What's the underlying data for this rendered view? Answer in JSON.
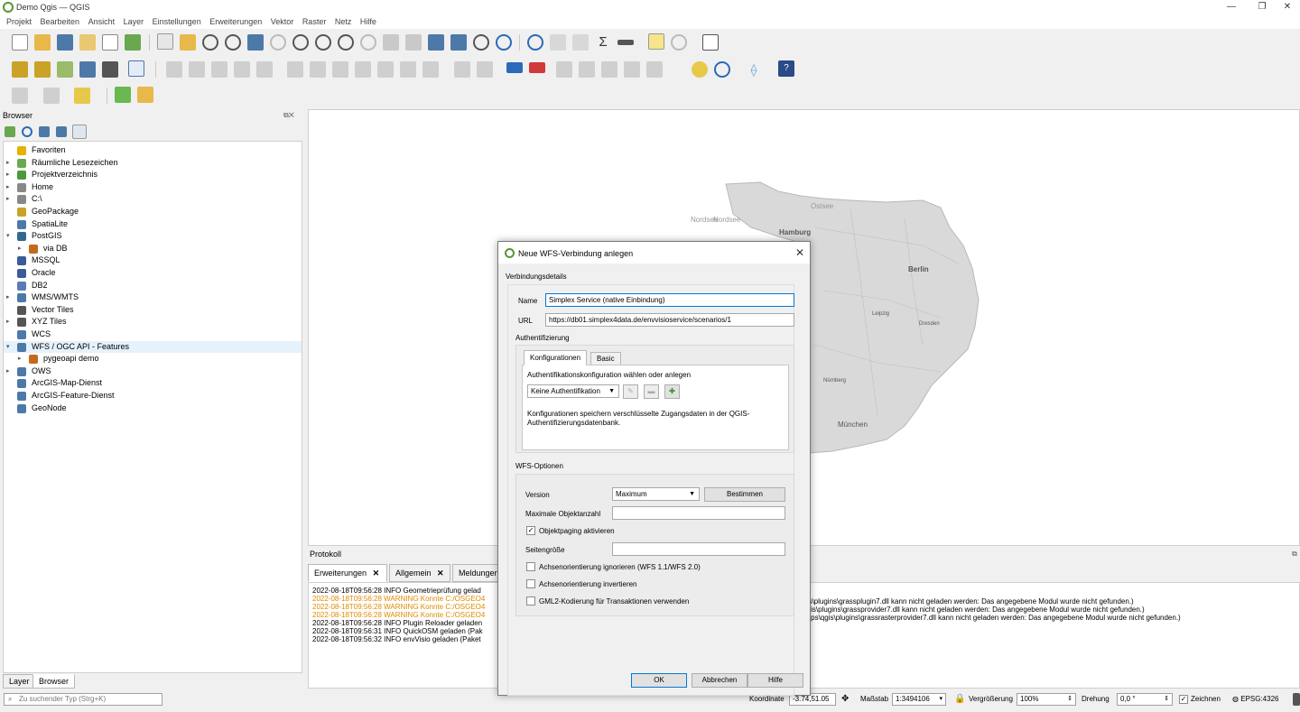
{
  "window": {
    "title": "Demo Qgis — QGIS",
    "minimize": "—",
    "restore": "❐",
    "close": "✕"
  },
  "menu": [
    "Projekt",
    "Bearbeiten",
    "Ansicht",
    "Layer",
    "Einstellungen",
    "Erweiterungen",
    "Vektor",
    "Raster",
    "Netz",
    "Hilfe"
  ],
  "browser": {
    "title": "Browser",
    "items": [
      {
        "label": "Favoriten",
        "icon": "star-icon",
        "color": "#e8b000",
        "arrow": ""
      },
      {
        "label": "Räumliche Lesezeichen",
        "icon": "bookmark-icon",
        "color": "#6aa84f",
        "arrow": "▸"
      },
      {
        "label": "Projektverzeichnis",
        "icon": "project-folder-icon",
        "color": "#4a9a3a",
        "arrow": "▸"
      },
      {
        "label": "Home",
        "icon": "home-icon",
        "color": "#888888",
        "arrow": "▸"
      },
      {
        "label": "C:\\",
        "icon": "drive-icon",
        "color": "#888888",
        "arrow": "▸"
      },
      {
        "label": "GeoPackage",
        "icon": "geopackage-icon",
        "color": "#c9a227",
        "arrow": ""
      },
      {
        "label": "SpatiaLite",
        "icon": "spatialite-icon",
        "color": "#4d79a8",
        "arrow": ""
      },
      {
        "label": "PostGIS",
        "icon": "postgis-icon",
        "color": "#336791",
        "arrow": "▾"
      },
      {
        "label": "via DB",
        "icon": "schema-icon",
        "color": "#c46a1b",
        "arrow": "▸",
        "indent": 1
      },
      {
        "label": "MSSQL",
        "icon": "mssql-icon",
        "color": "#3b5b98",
        "arrow": ""
      },
      {
        "label": "Oracle",
        "icon": "oracle-icon",
        "color": "#3b5b98",
        "arrow": ""
      },
      {
        "label": "DB2",
        "icon": "db2-icon",
        "color": "#5a7bb8",
        "arrow": ""
      },
      {
        "label": "WMS/WMTS",
        "icon": "wms-icon",
        "color": "#4d79a8",
        "arrow": "▸"
      },
      {
        "label": "Vector Tiles",
        "icon": "vector-tiles-icon",
        "color": "#555555",
        "arrow": ""
      },
      {
        "label": "XYZ Tiles",
        "icon": "xyz-tiles-icon",
        "color": "#555555",
        "arrow": "▸"
      },
      {
        "label": "WCS",
        "icon": "wcs-icon",
        "color": "#4d79a8",
        "arrow": ""
      },
      {
        "label": "WFS / OGC API - Features",
        "icon": "wfs-icon",
        "color": "#4d79a8",
        "arrow": "▾",
        "selected": true
      },
      {
        "label": "pygeoapi demo",
        "icon": "connection-icon",
        "color": "#c46a1b",
        "arrow": "▸",
        "indent": 1
      },
      {
        "label": "OWS",
        "icon": "ows-icon",
        "color": "#4d79a8",
        "arrow": "▸"
      },
      {
        "label": "ArcGIS-Map-Dienst",
        "icon": "arcgis-map-icon",
        "color": "#4d79a8",
        "arrow": ""
      },
      {
        "label": "ArcGIS-Feature-Dienst",
        "icon": "arcgis-feature-icon",
        "color": "#4d79a8",
        "arrow": ""
      },
      {
        "label": "GeoNode",
        "icon": "geonode-icon",
        "color": "#4d79a8",
        "arrow": ""
      }
    ]
  },
  "bottom_tabs": [
    "Layer",
    "Browser"
  ],
  "map_labels": [
    "Nordsee",
    "Ostsee",
    "Nordsee",
    "Hamburg",
    "Berlin",
    "Leipzig",
    "Dresden",
    "Nürnberg",
    "München"
  ],
  "protokoll": {
    "title": "Protokoll",
    "tabs": [
      "Erweiterungen",
      "Allgemein",
      "Meldungen"
    ],
    "close_glyph": "✕",
    "lines": [
      {
        "text": "2022-08-18T09:56:28   INFO   Geometrieprüfung gelad",
        "level": "info"
      },
      {
        "text": "2022-08-18T09:56:28   WARNING   Konnte C:/OSGEO4",
        "level": "warning"
      },
      {
        "text": "2022-08-18T09:56:28   WARNING   Konnte C:/OSGEO4",
        "level": "warning"
      },
      {
        "text": "2022-08-18T09:56:28   WARNING   Konnte C:/OSGEO4",
        "level": "warning"
      },
      {
        "text": "2022-08-18T09:56:28   INFO   Plugin Reloader geladen",
        "level": "info"
      },
      {
        "text": "2022-08-18T09:56:31   INFO   QuickOSM geladen (Pak",
        "level": "info"
      },
      {
        "text": "2022-08-18T09:56:32   INFO   envVisio geladen (Paket",
        "level": "info"
      }
    ],
    "right_lines": [
      "\\gis\\plugins\\grassplugin7.dll kann nicht geladen werden: Das angegebene Modul wurde nicht gefunden.)",
      "\\qgis\\plugins\\grassprovider7.dll kann nicht geladen werden: Das angegebene Modul wurde nicht gefunden.)",
      "\\apps\\qgis\\plugins\\grassrasterprovider7.dll kann nicht geladen werden: Das angegebene Modul wurde nicht gefunden.)"
    ]
  },
  "status": {
    "search_placeholder": "Zu suchender Typ (Strg+K)",
    "coord_label": "Koordinate",
    "coord_value": "-3.74,51.05",
    "scale_label": "Maßstab",
    "scale_value": "1:3494106",
    "zoom_label": "Vergrößerung",
    "zoom_value": "100%",
    "rotation_label": "Drehung",
    "rotation_value": "0,0 °",
    "render_label": "Zeichnen",
    "crs_label": "EPSG:4326"
  },
  "dialog": {
    "title": "Neue WFS-Verbindung anlegen",
    "section_conn": "Verbindungsdetails",
    "name_label": "Name",
    "name_value": "Simplex Service (native Einbindung)",
    "url_label": "URL",
    "url_value": "https://db01.simplex4data.de/envvisioservice/scenarios/1",
    "auth_section": "Authentifizierung",
    "auth_tabs": [
      "Konfigurationen",
      "Basic"
    ],
    "auth_prompt": "Authentifikationskonfiguration wählen oder anlegen",
    "auth_combo": "Keine Authentifikation",
    "auth_note": "Konfigurationen speichern verschlüsselte Zugangsdaten in der QGIS-Authentifizierungsdatenbank.",
    "wfs_section": "WFS-Optionen",
    "version_label": "Version",
    "version_value": "Maximum",
    "detect_button": "Bestimmen",
    "max_features_label": "Maximale Objektanzahl",
    "paging_label": "Objektpaging aktivieren",
    "paging_checked": "✓",
    "page_size_label": "Seitengröße",
    "ignore_axis_label": "Achsenorientierung ignorieren (WFS 1.1/WFS 2.0)",
    "invert_axis_label": "Achsenorientierung invertieren",
    "gml2_label": "GML2-Kodierung für Transaktionen verwenden",
    "ok": "OK",
    "cancel": "Abbrechen",
    "help": "Hilfe"
  },
  "colors": {
    "qgis_green": "#589632",
    "warning": "#e08a00",
    "accent": "#0078d7"
  }
}
